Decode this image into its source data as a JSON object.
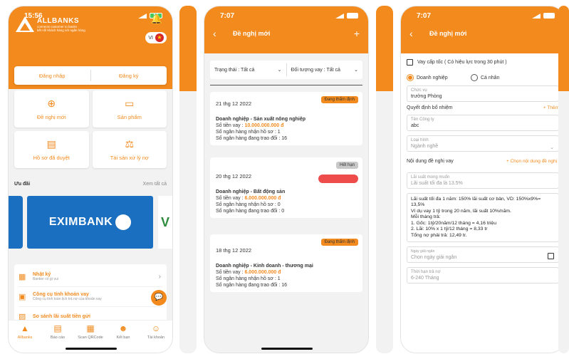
{
  "phone1": {
    "status": {
      "time": "15:56",
      "battery": "58"
    },
    "brand": {
      "name": "ALLBANKS",
      "tagline1": "connects customer to banks",
      "tagline2": "kết nối khách hàng với ngân hàng"
    },
    "lang": "VI",
    "auth": {
      "login": "Đăng nhập",
      "register": "Đăng ký"
    },
    "tiles": [
      {
        "label": "Đề nghị mới",
        "icon": "new-request-icon"
      },
      {
        "label": "Sản phẩm",
        "icon": "card-icon"
      },
      {
        "label": "Hồ sơ đã duyệt",
        "icon": "document-icon"
      },
      {
        "label": "Tài sản xử lý nợ",
        "icon": "asset-icon"
      }
    ],
    "offers": {
      "title": "Ưu đãi",
      "see_all": "Xem tất cả"
    },
    "banner": {
      "name": "EXIMBANK",
      "side": "V"
    },
    "list": [
      {
        "title": "Nhật ký",
        "sub": "Banker có gì vui"
      },
      {
        "title": "Công cụ tính khoản vay",
        "sub": "Công cụ tính toán lịch trả nợ của khoản vay"
      },
      {
        "title": "So sánh lãi suất tiền gửi",
        "sub": ""
      }
    ],
    "tabs": [
      "Allbanks",
      "Báo cáo",
      "Scan QRCode",
      "Kết bạn",
      "Tài khoản"
    ]
  },
  "phone2": {
    "status": {
      "time": "7:07"
    },
    "title": "Đề nghị mới",
    "filters": {
      "status": "Trạng thái : Tất cả",
      "target": "Đối tượng vay : Tất cả"
    },
    "cards": [
      {
        "date": "21 thg 12 2022",
        "badge": "Đang thẩm định",
        "kind": "Doanh nghiệp - Sản xuất nông nghiệp",
        "amount_label": "Số tiền vay : ",
        "amount": "10.000.000.000 đ",
        "banks_received": "Số ngân hàng nhận hồ sơ : 1",
        "banks_talking": "Số ngân hàng đang trao đổi : 16"
      },
      {
        "date": "20 thg 12 2022",
        "badge": "Hết hạn",
        "kind": "Doanh nghiệp - Bất động sản",
        "amount_label": "Số tiền vay : ",
        "amount": "6.000.000.000 đ",
        "banks_received": "Số ngân hàng nhận hồ sơ : 0",
        "banks_talking": "Số ngân hàng đang trao đổi : 0"
      },
      {
        "date": "18 thg 12 2022",
        "badge": "Đang thẩm định",
        "kind": "Doanh nghiệp - Kinh doanh - thương mại",
        "amount_label": "Số tiền vay : ",
        "amount": "6.000.000.000 đ",
        "banks_received": "Số ngân hàng nhận hồ sơ : 1",
        "banks_talking": "Số ngân hàng đang trao đổi : 16"
      }
    ]
  },
  "phone3": {
    "status": {
      "time": "7:07"
    },
    "title": "Đề nghị mới",
    "urgent": "Vay cấp tốc ( Có hiệu lực trong 30 phút )",
    "radio_business": "Doanh nghiệp",
    "radio_personal": "Cá nhân",
    "position": {
      "label": "Chức vụ",
      "value": "trưởng Phòng"
    },
    "appoint": {
      "label": "Quyết định bổ nhiệm",
      "action": "+ Thêm"
    },
    "company": {
      "label": "Tên Công ty",
      "value": "abc"
    },
    "type": {
      "label": "Loại hình",
      "value": "Ngành nghề"
    },
    "content": {
      "label": "Nội dung đề nghị vay",
      "action": "+ Chọn nội dung đề nghị"
    },
    "rate": {
      "label": "Lãi suất mong muốn",
      "placeholder": "Lãi suất tối đa là 13.5%"
    },
    "rate_note": [
      "Lãi suất tối đa 1 năm: 150% lãi suất cơ bản, VD: 150%x9%= 13,5%",
      "Ví dụ vay 1 tỷ trong 20 năm, lãi suất 10%/năm.",
      "Mỗi tháng trả:",
      "1. Gốc: 1tỷ/20năm/12 tháng = 4,16 triệu",
      "2. Lãi: 10% x 1 tỷ/12 tháng = 8,33 tr",
      "Tổng nợ phải trả: 12,49 tr."
    ],
    "disburse": {
      "label": "Ngày giải ngân",
      "placeholder": "Chọn ngày giải ngân"
    },
    "term": {
      "label": "Thời hạn trả nợ",
      "placeholder": "6-240 Tháng"
    }
  },
  "colors": {
    "accent": "#f28a1e",
    "bank_blue": "#1a6fc0",
    "expired_red": "#ee4b4b"
  }
}
